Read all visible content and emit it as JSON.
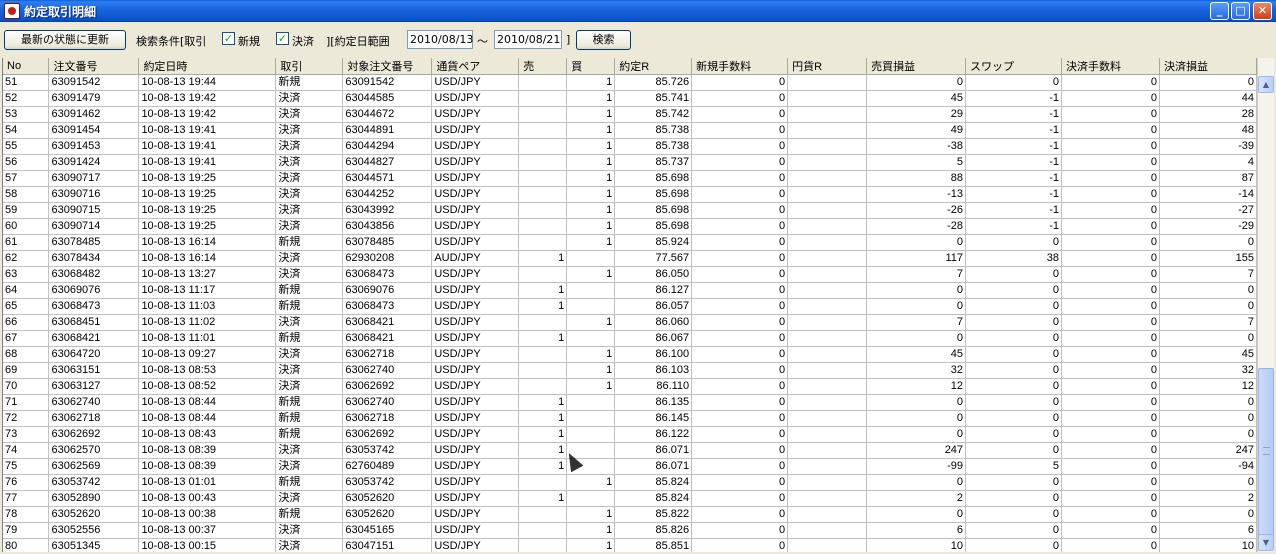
{
  "window": {
    "title": "約定取引明細",
    "minimize": "_",
    "maximize": "□",
    "close": "✕"
  },
  "toolbar": {
    "refresh_label": "最新の状態に更新",
    "criteria_label": "検索条件[取引",
    "new_checkbox": {
      "label": "新規",
      "checked": true
    },
    "settle_checkbox": {
      "label": "決済",
      "checked": true
    },
    "range_label": "][約定日範囲",
    "date_from": "2010/08/13",
    "tilde": "～",
    "date_to": "2010/08/21",
    "range_close": "]",
    "search_label": "検索"
  },
  "columns": [
    "No",
    "注文番号",
    "約定日時",
    "取引",
    "対象注文番号",
    "通貨ペア",
    "売",
    "買",
    "約定R",
    "新規手数料",
    "円貨R",
    "売買損益",
    "スワップ",
    "決済手数料",
    "決済損益"
  ],
  "rows": [
    [
      "51",
      "63091542",
      "10-08-13 19:44",
      "新規",
      "63091542",
      "USD/JPY",
      "",
      "1",
      "85.726",
      "0",
      "",
      "0",
      "0",
      "0",
      "0"
    ],
    [
      "52",
      "63091479",
      "10-08-13 19:42",
      "決済",
      "63044585",
      "USD/JPY",
      "",
      "1",
      "85.741",
      "0",
      "",
      "45",
      "-1",
      "0",
      "44"
    ],
    [
      "53",
      "63091462",
      "10-08-13 19:42",
      "決済",
      "63044672",
      "USD/JPY",
      "",
      "1",
      "85.742",
      "0",
      "",
      "29",
      "-1",
      "0",
      "28"
    ],
    [
      "54",
      "63091454",
      "10-08-13 19:41",
      "決済",
      "63044891",
      "USD/JPY",
      "",
      "1",
      "85.738",
      "0",
      "",
      "49",
      "-1",
      "0",
      "48"
    ],
    [
      "55",
      "63091453",
      "10-08-13 19:41",
      "決済",
      "63044294",
      "USD/JPY",
      "",
      "1",
      "85.738",
      "0",
      "",
      "-38",
      "-1",
      "0",
      "-39"
    ],
    [
      "56",
      "63091424",
      "10-08-13 19:41",
      "決済",
      "63044827",
      "USD/JPY",
      "",
      "1",
      "85.737",
      "0",
      "",
      "5",
      "-1",
      "0",
      "4"
    ],
    [
      "57",
      "63090717",
      "10-08-13 19:25",
      "決済",
      "63044571",
      "USD/JPY",
      "",
      "1",
      "85.698",
      "0",
      "",
      "88",
      "-1",
      "0",
      "87"
    ],
    [
      "58",
      "63090716",
      "10-08-13 19:25",
      "決済",
      "63044252",
      "USD/JPY",
      "",
      "1",
      "85.698",
      "0",
      "",
      "-13",
      "-1",
      "0",
      "-14"
    ],
    [
      "59",
      "63090715",
      "10-08-13 19:25",
      "決済",
      "63043992",
      "USD/JPY",
      "",
      "1",
      "85.698",
      "0",
      "",
      "-26",
      "-1",
      "0",
      "-27"
    ],
    [
      "60",
      "63090714",
      "10-08-13 19:25",
      "決済",
      "63043856",
      "USD/JPY",
      "",
      "1",
      "85.698",
      "0",
      "",
      "-28",
      "-1",
      "0",
      "-29"
    ],
    [
      "61",
      "63078485",
      "10-08-13 16:14",
      "新規",
      "63078485",
      "USD/JPY",
      "",
      "1",
      "85.924",
      "0",
      "",
      "0",
      "0",
      "0",
      "0"
    ],
    [
      "62",
      "63078434",
      "10-08-13 16:14",
      "決済",
      "62930208",
      "AUD/JPY",
      "1",
      "",
      "77.567",
      "0",
      "",
      "117",
      "38",
      "0",
      "155"
    ],
    [
      "63",
      "63068482",
      "10-08-13 13:27",
      "決済",
      "63068473",
      "USD/JPY",
      "",
      "1",
      "86.050",
      "0",
      "",
      "7",
      "0",
      "0",
      "7"
    ],
    [
      "64",
      "63069076",
      "10-08-13 11:17",
      "新規",
      "63069076",
      "USD/JPY",
      "1",
      "",
      "86.127",
      "0",
      "",
      "0",
      "0",
      "0",
      "0"
    ],
    [
      "65",
      "63068473",
      "10-08-13 11:03",
      "新規",
      "63068473",
      "USD/JPY",
      "1",
      "",
      "86.057",
      "0",
      "",
      "0",
      "0",
      "0",
      "0"
    ],
    [
      "66",
      "63068451",
      "10-08-13 11:02",
      "決済",
      "63068421",
      "USD/JPY",
      "",
      "1",
      "86.060",
      "0",
      "",
      "7",
      "0",
      "0",
      "7"
    ],
    [
      "67",
      "63068421",
      "10-08-13 11:01",
      "新規",
      "63068421",
      "USD/JPY",
      "1",
      "",
      "86.067",
      "0",
      "",
      "0",
      "0",
      "0",
      "0"
    ],
    [
      "68",
      "63064720",
      "10-08-13 09:27",
      "決済",
      "63062718",
      "USD/JPY",
      "",
      "1",
      "86.100",
      "0",
      "",
      "45",
      "0",
      "0",
      "45"
    ],
    [
      "69",
      "63063151",
      "10-08-13 08:53",
      "決済",
      "63062740",
      "USD/JPY",
      "",
      "1",
      "86.103",
      "0",
      "",
      "32",
      "0",
      "0",
      "32"
    ],
    [
      "70",
      "63063127",
      "10-08-13 08:52",
      "決済",
      "63062692",
      "USD/JPY",
      "",
      "1",
      "86.110",
      "0",
      "",
      "12",
      "0",
      "0",
      "12"
    ],
    [
      "71",
      "63062740",
      "10-08-13 08:44",
      "新規",
      "63062740",
      "USD/JPY",
      "1",
      "",
      "86.135",
      "0",
      "",
      "0",
      "0",
      "0",
      "0"
    ],
    [
      "72",
      "63062718",
      "10-08-13 08:44",
      "新規",
      "63062718",
      "USD/JPY",
      "1",
      "",
      "86.145",
      "0",
      "",
      "0",
      "0",
      "0",
      "0"
    ],
    [
      "73",
      "63062692",
      "10-08-13 08:43",
      "新規",
      "63062692",
      "USD/JPY",
      "1",
      "",
      "86.122",
      "0",
      "",
      "0",
      "0",
      "0",
      "0"
    ],
    [
      "74",
      "63062570",
      "10-08-13 08:39",
      "決済",
      "63053742",
      "USD/JPY",
      "1",
      "",
      "86.071",
      "0",
      "",
      "247",
      "0",
      "0",
      "247"
    ],
    [
      "75",
      "63062569",
      "10-08-13 08:39",
      "決済",
      "62760489",
      "USD/JPY",
      "1",
      "",
      "86.071",
      "0",
      "",
      "-99",
      "5",
      "0",
      "-94"
    ],
    [
      "76",
      "63053742",
      "10-08-13 01:01",
      "新規",
      "63053742",
      "USD/JPY",
      "",
      "1",
      "85.824",
      "0",
      "",
      "0",
      "0",
      "0",
      "0"
    ],
    [
      "77",
      "63052890",
      "10-08-13 00:43",
      "決済",
      "63052620",
      "USD/JPY",
      "1",
      "",
      "85.824",
      "0",
      "",
      "2",
      "0",
      "0",
      "2"
    ],
    [
      "78",
      "63052620",
      "10-08-13 00:38",
      "新規",
      "63052620",
      "USD/JPY",
      "",
      "1",
      "85.822",
      "0",
      "",
      "0",
      "0",
      "0",
      "0"
    ],
    [
      "79",
      "63052556",
      "10-08-13 00:37",
      "決済",
      "63045165",
      "USD/JPY",
      "",
      "1",
      "85.826",
      "0",
      "",
      "6",
      "0",
      "0",
      "6"
    ],
    [
      "80",
      "63051345",
      "10-08-13 00:15",
      "決済",
      "63047151",
      "USD/JPY",
      "",
      "1",
      "85.851",
      "0",
      "",
      "10",
      "0",
      "0",
      "10"
    ]
  ]
}
